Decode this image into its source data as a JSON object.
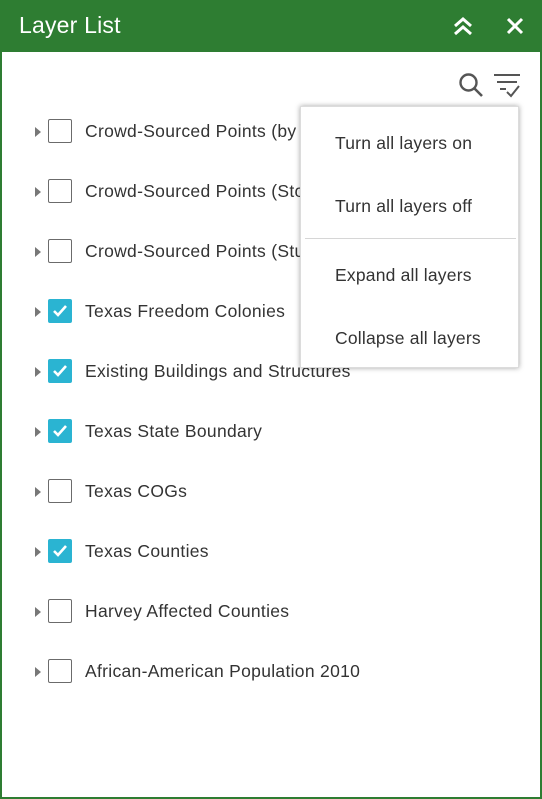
{
  "header": {
    "title": "Layer List",
    "collapse_icon": "double-chevron-up-icon",
    "close_icon": "close-icon",
    "color": "#2e7d32"
  },
  "toolbar": {
    "search_icon": "search-icon",
    "filter_icon": "filter-menu-icon"
  },
  "layers": [
    {
      "label": "Crowd-Sourced Points (by",
      "checked": false
    },
    {
      "label": "Crowd-Sourced Points (Sto",
      "checked": false
    },
    {
      "label": "Crowd-Sourced Points (Stu",
      "checked": false
    },
    {
      "label": "Texas Freedom Colonies",
      "checked": true
    },
    {
      "label": "Existing Buildings and Structures",
      "checked": true
    },
    {
      "label": "Texas State Boundary",
      "checked": true
    },
    {
      "label": "Texas COGs",
      "checked": false
    },
    {
      "label": "Texas Counties",
      "checked": true
    },
    {
      "label": "Harvey Affected Counties",
      "checked": false
    },
    {
      "label": "African-American Population 2010",
      "checked": false
    }
  ],
  "menu": {
    "items": [
      {
        "label": "Turn all layers on"
      },
      {
        "label": "Turn all layers off"
      },
      {
        "label": "Expand all layers"
      },
      {
        "label": "Collapse all layers"
      }
    ]
  },
  "colors": {
    "checkbox_checked": "#2ab4d2",
    "text": "#333333"
  }
}
